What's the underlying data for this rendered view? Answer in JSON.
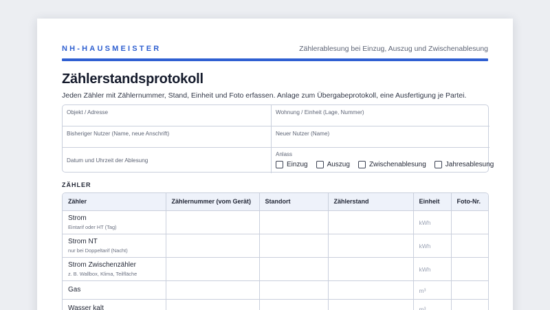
{
  "header": {
    "brand": "NH-HAUSMEISTER",
    "tagline": "Zählerablesung bei Einzug, Auszug und Zwischenablesung"
  },
  "title": "Zählerstandsprotokoll",
  "subtitle": "Jeden Zähler mit Zählernummer, Stand, Einheit und Foto erfassen. Anlage zum Übergabeprotokoll, eine Ausfertigung je Partei.",
  "info": {
    "objekt": "Objekt / Adresse",
    "wohnung": "Wohnung / Einheit (Lage, Nummer)",
    "bisheriger": "Bisheriger Nutzer (Name, neue Anschrift)",
    "neuer": "Neuer Nutzer (Name)",
    "datum": "Datum und Uhrzeit der Ablesung",
    "anlass_label": "Anlass",
    "anlass_options": [
      "Einzug",
      "Auszug",
      "Zwischenablesung",
      "Jahresablesung"
    ]
  },
  "section_label": "ZÄHLER",
  "table": {
    "headers": [
      "Zähler",
      "Zählernummer (vom Gerät)",
      "Standort",
      "Zählerstand",
      "Einheit",
      "Foto-Nr."
    ],
    "rows": [
      {
        "name": "Strom",
        "sub": "Eintarif oder HT (Tag)",
        "unit": "kWh"
      },
      {
        "name": "Strom NT",
        "sub": "nur bei Doppeltarif (Nacht)",
        "unit": "kWh"
      },
      {
        "name": "Strom Zwischenzähler",
        "sub": "z. B. Wallbox, Klima, Teilfläche",
        "unit": "kWh"
      },
      {
        "name": "Gas",
        "sub": "",
        "unit": "m³"
      },
      {
        "name": "Wasser kalt",
        "sub": "",
        "unit": "m³"
      }
    ]
  }
}
